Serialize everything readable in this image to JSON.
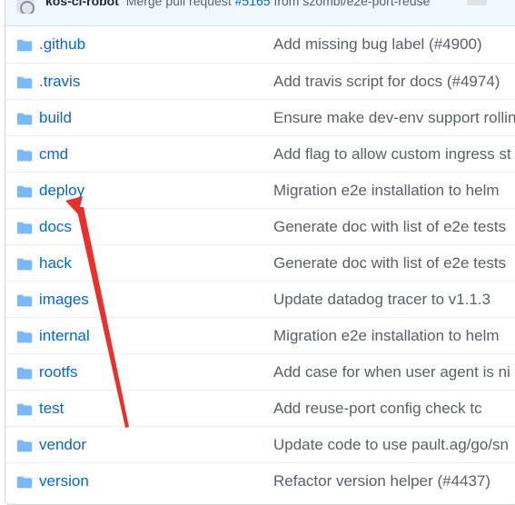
{
  "commit": {
    "author": "kos-ci-robot",
    "message_prefix": "Merge pull request",
    "pr": "#5165",
    "message_suffix": "from szombi/e2e-port-reuse",
    "more": "…"
  },
  "files": [
    {
      "name": ".github",
      "message": "Add missing bug label (#4900)"
    },
    {
      "name": ".travis",
      "message": "Add travis script for docs (#4974)"
    },
    {
      "name": "build",
      "message": "Ensure make dev-env support rollin"
    },
    {
      "name": "cmd",
      "message": "Add flag to allow custom ingress st"
    },
    {
      "name": "deploy",
      "message": "Migration e2e installation to helm"
    },
    {
      "name": "docs",
      "message": "Generate doc with list of e2e tests"
    },
    {
      "name": "hack",
      "message": "Generate doc with list of e2e tests"
    },
    {
      "name": "images",
      "message": "Update datadog tracer to v1.1.3"
    },
    {
      "name": "internal",
      "message": "Migration e2e installation to helm"
    },
    {
      "name": "rootfs",
      "message": "Add case for when user agent is ni"
    },
    {
      "name": "test",
      "message": "Add reuse-port config check tc"
    },
    {
      "name": "vendor",
      "message": "Update code to use pault.ag/go/sn"
    },
    {
      "name": "version",
      "message": "Refactor version helper (#4437)"
    }
  ],
  "colors": {
    "link": "#0366d6",
    "folder_icon": "#79b8ff",
    "message_text": "#586069",
    "annotation_arrow": "#e8312a"
  },
  "icons": {
    "row_icon": "folder-icon",
    "avatar": "avatar-icon"
  },
  "annotation": {
    "type": "arrow",
    "points_to": "deploy"
  }
}
